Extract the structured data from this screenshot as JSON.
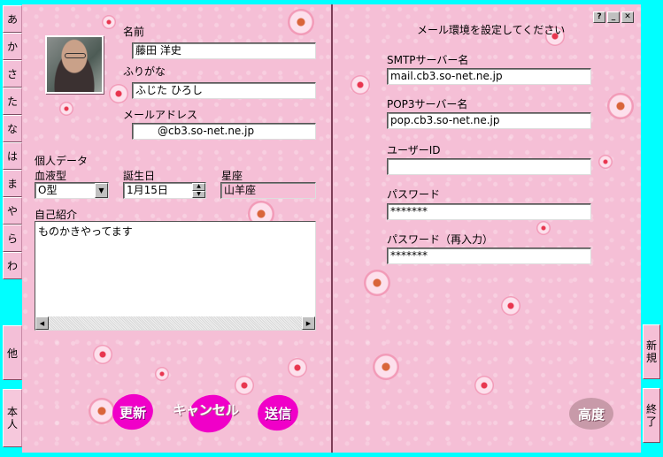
{
  "left_tabs": [
    "あ",
    "か",
    "さ",
    "た",
    "な",
    "は",
    "ま",
    "や",
    "ら",
    "わ",
    "他",
    "本人"
  ],
  "profile": {
    "name_label": "名前",
    "name_value": "藤田 洋史",
    "furigana_label": "ふりがな",
    "furigana_value": "ふじた ひろし",
    "email_label": "メールアドレス",
    "email_value": "@cb3.so-net.ne.jp",
    "personal_data_label": "個人データ",
    "blood_type_label": "血液型",
    "blood_type_value": "O型",
    "birthday_label": "誕生日",
    "birthday_value": "1月15日",
    "zodiac_label": "星座",
    "zodiac_value": "山羊座",
    "intro_label": "自己紹介",
    "intro_value": "ものかきやってます"
  },
  "buttons": {
    "update": "更新",
    "cancel": "キャンセル",
    "send": "送信",
    "advanced": "高度"
  },
  "mail_settings": {
    "title": "メール環境を設定してください",
    "smtp_label": "SMTPサーバー名",
    "smtp_value": "mail.cb3.so-net.ne.jp",
    "pop3_label": "POP3サーバー名",
    "pop3_value": "pop.cb3.so-net.ne.jp",
    "user_id_label": "ユーザーID",
    "user_id_value": "",
    "password_label": "パスワード",
    "password_value": "*******",
    "password_confirm_label": "パスワード（再入力）",
    "password_confirm_value": "*******"
  },
  "window_buttons": {
    "help": "?",
    "minimize": "_",
    "close": "✕"
  },
  "right_tabs": {
    "new": "新規",
    "exit": "終了"
  },
  "colors": {
    "page": "#f5bfd6",
    "frame": "#00ffff",
    "accent_button": "#f000c8"
  }
}
